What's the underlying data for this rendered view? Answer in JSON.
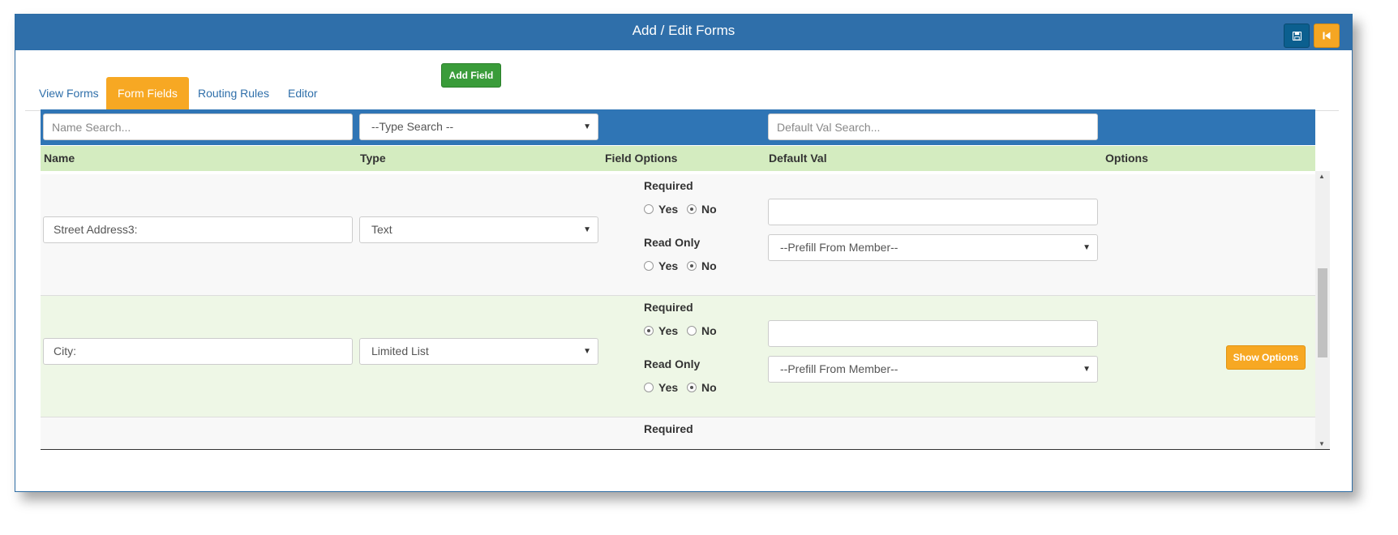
{
  "window": {
    "title": "Add / Edit Forms",
    "save_icon": "floppy-disk-icon",
    "back_icon": "step-backward-icon"
  },
  "tabs": [
    {
      "label": "View Forms",
      "active": false
    },
    {
      "label": "Form Fields",
      "active": true
    },
    {
      "label": "Routing Rules",
      "active": false
    },
    {
      "label": "Editor",
      "active": false
    }
  ],
  "add_field_label": "Add Field",
  "search": {
    "name_placeholder": "Name Search...",
    "type_value": "--Type Search --",
    "default_placeholder": "Default Val Search..."
  },
  "columns": {
    "name": "Name",
    "type": "Type",
    "field_options": "Field Options",
    "default_val": "Default Val",
    "options": "Options"
  },
  "option_labels": {
    "required": "Required",
    "read_only": "Read Only",
    "yes": "Yes",
    "no": "No"
  },
  "rows": [
    {
      "name": "Street Address3:",
      "type": "Text",
      "required": "No",
      "read_only": "No",
      "default_val": "",
      "prefill": "--Prefill From Member--",
      "show_options": false
    },
    {
      "name": "City:",
      "type": "Limited List",
      "required": "Yes",
      "read_only": "No",
      "default_val": "",
      "prefill": "--Prefill From Member--",
      "show_options": true,
      "show_options_label": "Show Options"
    }
  ],
  "partial_row_label": "Required",
  "colors": {
    "header_blue": "#2f6faa",
    "active_tab": "#f7a823",
    "add_button": "#3a9c3a",
    "header_green": "#d4ecc0"
  }
}
